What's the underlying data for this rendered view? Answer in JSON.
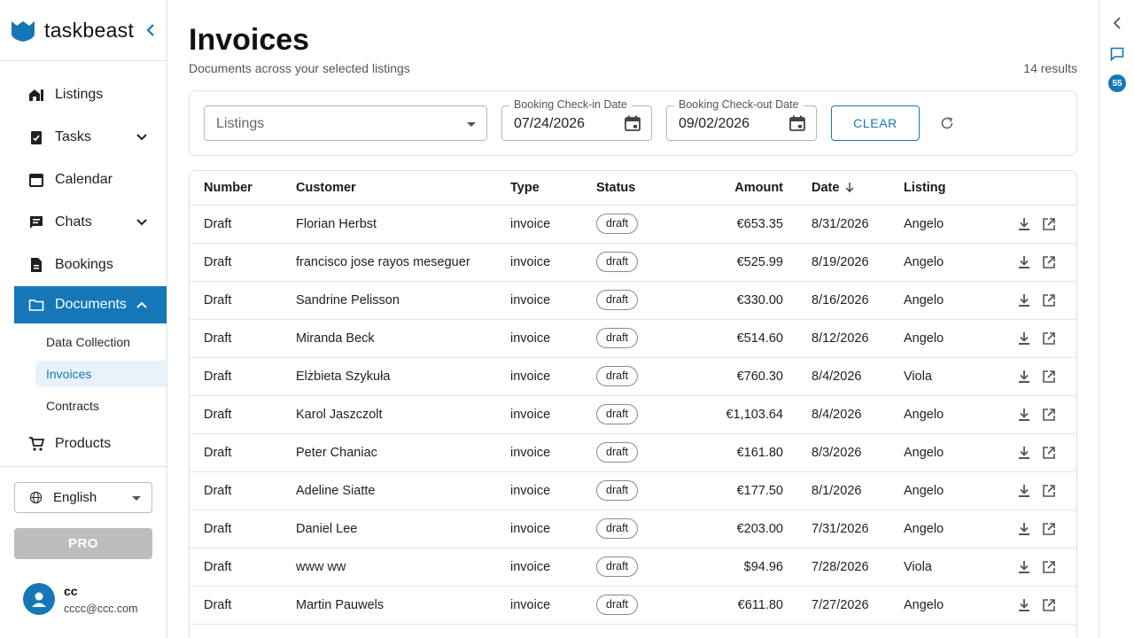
{
  "brand": {
    "name": "taskbeast"
  },
  "nav": {
    "listings": "Listings",
    "tasks": "Tasks",
    "calendar": "Calendar",
    "chats": "Chats",
    "bookings": "Bookings",
    "documents": "Documents",
    "sub": {
      "data_collection": "Data Collection",
      "invoices": "Invoices",
      "contracts": "Contracts"
    },
    "products": "Products"
  },
  "language": {
    "selected": "English"
  },
  "pro_label": "PRO",
  "user": {
    "name": "cc",
    "email": "cccc@ccc.com"
  },
  "page": {
    "title": "Invoices",
    "subtitle": "Documents across your selected listings",
    "results": "14 results"
  },
  "filters": {
    "listings_placeholder": "Listings",
    "checkin_label": "Booking Check-in Date",
    "checkin_value": "07/24/2026",
    "checkout_label": "Booking Check-out Date",
    "checkout_value": "09/02/2026",
    "clear_label": "CLEAR"
  },
  "table": {
    "headers": {
      "number": "Number",
      "customer": "Customer",
      "type": "Type",
      "status": "Status",
      "amount": "Amount",
      "date": "Date",
      "listing": "Listing"
    },
    "rows": [
      {
        "number": "Draft",
        "customer": "Florian Herbst",
        "type": "invoice",
        "status": "draft",
        "amount": "€653.35",
        "date": "8/31/2026",
        "listing": "Angelo"
      },
      {
        "number": "Draft",
        "customer": "francisco jose rayos meseguer",
        "type": "invoice",
        "status": "draft",
        "amount": "€525.99",
        "date": "8/19/2026",
        "listing": "Angelo"
      },
      {
        "number": "Draft",
        "customer": "Sandrine Pelisson",
        "type": "invoice",
        "status": "draft",
        "amount": "€330.00",
        "date": "8/16/2026",
        "listing": "Angelo"
      },
      {
        "number": "Draft",
        "customer": "Miranda Beck",
        "type": "invoice",
        "status": "draft",
        "amount": "€514.60",
        "date": "8/12/2026",
        "listing": "Angelo"
      },
      {
        "number": "Draft",
        "customer": "Elżbieta Szykuła",
        "type": "invoice",
        "status": "draft",
        "amount": "€760.30",
        "date": "8/4/2026",
        "listing": "Viola"
      },
      {
        "number": "Draft",
        "customer": "Karol Jaszczolt",
        "type": "invoice",
        "status": "draft",
        "amount": "€1,103.64",
        "date": "8/4/2026",
        "listing": "Angelo"
      },
      {
        "number": "Draft",
        "customer": "Peter Chaniac",
        "type": "invoice",
        "status": "draft",
        "amount": "€161.80",
        "date": "8/3/2026",
        "listing": "Angelo"
      },
      {
        "number": "Draft",
        "customer": "Adeline Siatte",
        "type": "invoice",
        "status": "draft",
        "amount": "€177.50",
        "date": "8/1/2026",
        "listing": "Angelo"
      },
      {
        "number": "Draft",
        "customer": "Daniel Lee",
        "type": "invoice",
        "status": "draft",
        "amount": "€203.00",
        "date": "7/31/2026",
        "listing": "Angelo"
      },
      {
        "number": "Draft",
        "customer": "www ww",
        "type": "invoice",
        "status": "draft",
        "amount": "$94.96",
        "date": "7/28/2026",
        "listing": "Viola"
      },
      {
        "number": "Draft",
        "customer": "Martin Pauwels",
        "type": "invoice",
        "status": "draft",
        "amount": "€611.80",
        "date": "7/27/2026",
        "listing": "Angelo"
      }
    ]
  },
  "right_rail": {
    "notification_count": "55"
  },
  "colors": {
    "accent": "#1677b8",
    "pro_disabled": "#bdbdbd"
  }
}
